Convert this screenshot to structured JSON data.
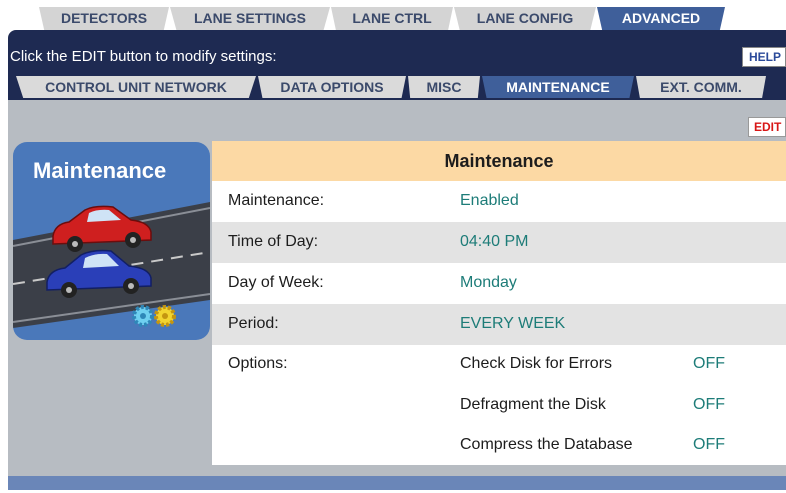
{
  "top_tabs": [
    {
      "label": "DETECTORS",
      "active": false
    },
    {
      "label": "LANE SETTINGS",
      "active": false
    },
    {
      "label": "LANE CTRL",
      "active": false
    },
    {
      "label": "LANE CONFIG",
      "active": false
    },
    {
      "label": "ADVANCED",
      "active": true
    }
  ],
  "instruction": "Click the EDIT button to modify settings:",
  "help_label": "HELP",
  "sub_tabs": [
    {
      "label": "CONTROL UNIT NETWORK",
      "active": false
    },
    {
      "label": "DATA OPTIONS",
      "active": false
    },
    {
      "label": "MISC",
      "active": false
    },
    {
      "label": "MAINTENANCE",
      "active": true
    },
    {
      "label": "EXT. COMM.",
      "active": false
    }
  ],
  "edit_label": "EDIT",
  "panel_title": "Maintenance",
  "table": {
    "header": "Maintenance",
    "rows": [
      {
        "label": "Maintenance:",
        "value": "Enabled"
      },
      {
        "label": "Time of Day:",
        "value": "04:40 PM"
      },
      {
        "label": "Day of Week:",
        "value": "Monday"
      },
      {
        "label": "Period:",
        "value": "EVERY WEEK"
      }
    ],
    "options_label": "Options:",
    "options": [
      {
        "name": "Check Disk for Errors",
        "value": "OFF"
      },
      {
        "name": "Defragment the Disk",
        "value": "OFF"
      },
      {
        "name": "Compress the Database",
        "value": "OFF"
      }
    ]
  },
  "colors": {
    "nav_dark": "#1e2a52",
    "active_tab": "#3f5f9a",
    "header_bg": "#fcd9a4",
    "value_text": "#1d7c78",
    "edit_text": "#d81616"
  },
  "icons": [
    "red-car-icon",
    "blue-car-icon",
    "gear-icon",
    "arrow-icon"
  ]
}
